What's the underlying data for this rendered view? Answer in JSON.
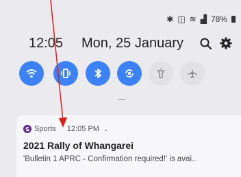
{
  "status_bar": {
    "icons": [
      "bluetooth-icon",
      "vibrate-icon",
      "wifi-icon",
      "signal-icon"
    ],
    "battery": "78%"
  },
  "header": {
    "time": "12:05",
    "date": "Mon, 25 January"
  },
  "quick_toggles": [
    {
      "name": "wifi-toggle",
      "icon": "wifi-icon",
      "state": "on"
    },
    {
      "name": "sound-toggle",
      "icon": "vibrate-icon",
      "state": "on"
    },
    {
      "name": "bluetooth-toggle",
      "icon": "bluetooth-icon",
      "state": "on"
    },
    {
      "name": "auto-rotate-toggle",
      "icon": "rotate-icon",
      "state": "on"
    },
    {
      "name": "flashlight-toggle",
      "icon": "flashlight-icon",
      "state": "off"
    },
    {
      "name": "airplane-toggle",
      "icon": "airplane-icon",
      "state": "off"
    }
  ],
  "notification": {
    "app": "Sports",
    "time": "12:05 PM",
    "title": "2021 Rally of Whangarei",
    "body": "'Bulletin 1 APRC - Confirmation required!' is avai.."
  },
  "colors": {
    "accent": "#3b82f6",
    "panel_bg": "#eaeaef",
    "arrow": "#e11d1d"
  }
}
